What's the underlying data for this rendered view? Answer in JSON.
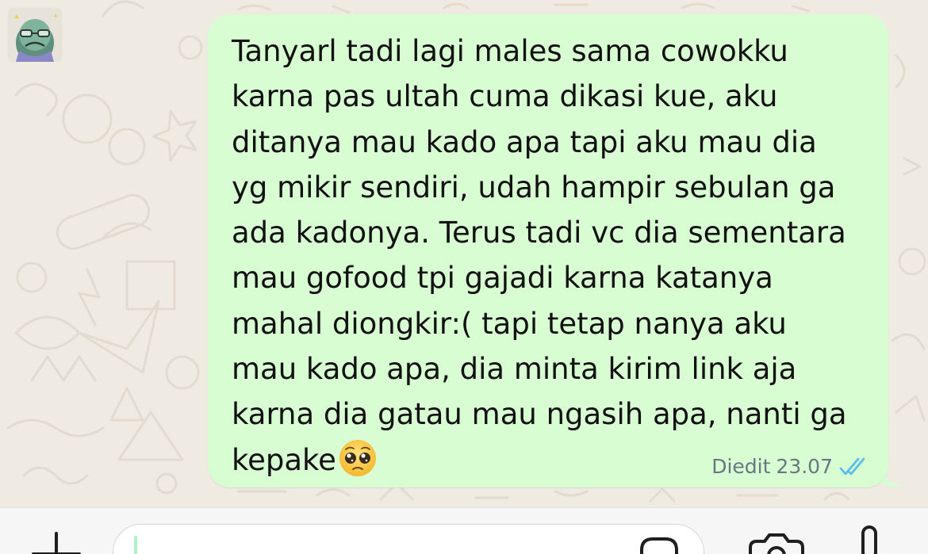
{
  "chat": {
    "message": {
      "text": "Tanyarl tadi lagi males sama cowokku\nkarna pas ultah cuma dikasi kue, aku\nditanya mau kado apa tapi aku mau dia\nyg mikir sendiri, udah hampir sebulan ga\nada kadonya. Terus tadi vc dia sementara\nmau gofood tpi gajadi karna katanya\nmahal diongkir:( tapi tetap nanya aku\nmau kado apa, dia minta kirim link aja\nkarna dia gatau mau ngasih apa, nanti ga\nkepake",
      "emoji": "pleading-face",
      "edited_label": "Diedit",
      "time": "23.07",
      "status_icon": "double-check-read-icon",
      "bubble_color": "#d9fdd3",
      "read_tick_color": "#53bdeb"
    },
    "avatar_icon": "sticker-avatar-icon"
  },
  "composer": {
    "plus_icon": "plus-icon",
    "input_value": "",
    "sticker_icon": "sticker-icon",
    "camera_icon": "camera-icon",
    "mic_icon": "microphone-icon",
    "accent": "#25d366"
  }
}
